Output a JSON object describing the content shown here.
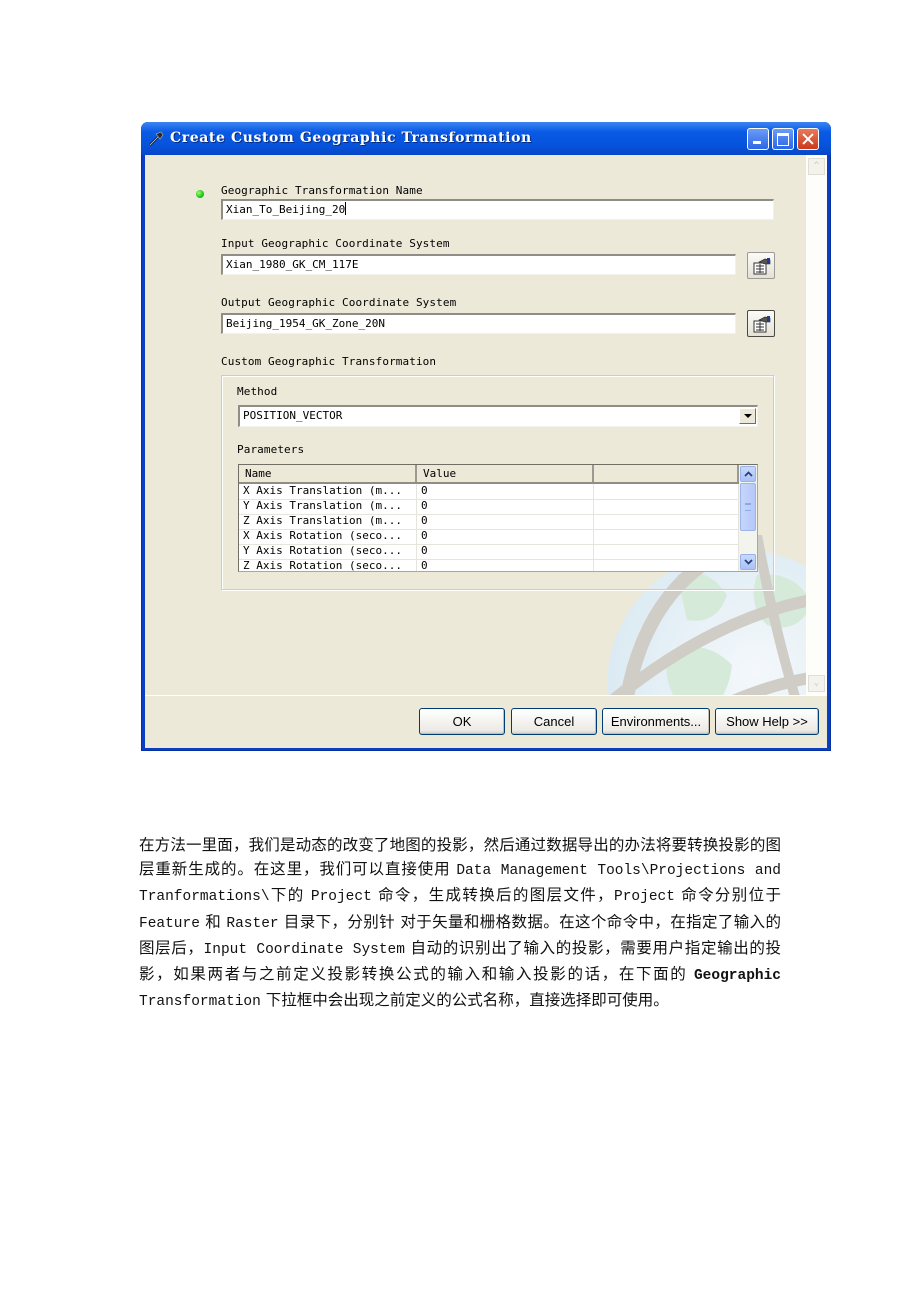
{
  "dialog": {
    "title": "Create Custom Geographic Transformation",
    "icons": {
      "title": "hammer-tool-icon",
      "minimize": "minimize-icon",
      "maximize": "maximize-icon",
      "close": "close-icon"
    },
    "fields": {
      "transformation_name": {
        "label": "Geographic Transformation Name",
        "value": "Xian_To_Beijing_20",
        "required_indicator": "green-dot-icon"
      },
      "input_gcs": {
        "label": "Input Geographic Coordinate System",
        "value": "Xian_1980_GK_CM_117E",
        "browse_icon": "coordinate-system-properties-icon"
      },
      "output_gcs": {
        "label": "Output Geographic Coordinate System",
        "value": "Beijing_1954_GK_Zone_20N",
        "browse_icon": "coordinate-system-properties-icon"
      }
    },
    "custom_transformation": {
      "label": "Custom Geographic Transformation",
      "method_label": "Method",
      "method_value": "POSITION_VECTOR",
      "parameters_label": "Parameters",
      "table": {
        "columns": [
          "Name",
          "Value",
          ""
        ],
        "rows": [
          {
            "name": "X Axis Translation (m...",
            "value": "0"
          },
          {
            "name": "Y Axis Translation (m...",
            "value": "0"
          },
          {
            "name": "Z Axis Translation (m...",
            "value": "0"
          },
          {
            "name": "X Axis Rotation (seco...",
            "value": "0"
          },
          {
            "name": "Y Axis Rotation (seco...",
            "value": "0"
          },
          {
            "name": "Z Axis Rotation (seco...",
            "value": "0"
          }
        ]
      }
    },
    "buttons": {
      "ok": "OK",
      "cancel": "Cancel",
      "environments": "Environments...",
      "show_help": "Show Help >>"
    },
    "colors": {
      "titlebar": "#0654dc",
      "face": "#ece9d8",
      "required_dot": "#1cc41c"
    }
  },
  "document": {
    "paragraph_parts": {
      "p1": "在方法一里面，我们是动态的改变了地图的投影，然后通过数据导出的办法将要转换投影的图层重新生成的。在这里，我们可以直接使用 ",
      "p2": "Data Management Tools\\Projections and Tranformations\\",
      "p3": "下的 ",
      "p4": "Project",
      "p5": " 命令，生成转换后的图层文件，",
      "p6": "Project",
      "p7": " 命令分别位于 ",
      "p8": "Feature",
      "p9": " 和 ",
      "p10": "Raster",
      "p11": " 目录下，分别针 对于矢量和栅格数据。在这个命令中，在指定了输入的图层后，",
      "p12": "Input Coordinate System",
      "p13": " 自动的识别出了输入的投影，需要用户指定输出的投影，如果两者与之前定义投影转换公式的输入和输入投影的话，在下面的 ",
      "p14": "Geographic",
      "p15": " ",
      "p16": "Transformation",
      "p17": " 下拉框中会出现之前定义的公式名称，直接选择即可使用。"
    }
  }
}
